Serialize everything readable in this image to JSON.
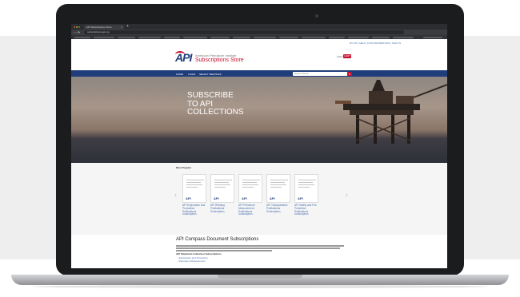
{
  "browser": {
    "tab_title": "API Subscriptions Store",
    "tab_close": "×",
    "new_tab": "+",
    "nav_buttons": "‹ › ⟳",
    "url": "subscriptions.api.org"
  },
  "site": {
    "utility_links": "MY API  |  HELP  |  FOR INFORMATION  |  SIGN IN",
    "logo": "API",
    "brand_line1": "American Petroleum Institute",
    "brand_line2": "Subscriptions Store",
    "login_label": "LOG IN",
    "cart_label": "CART",
    "nav": [
      "HOME",
      "LOGIN",
      "SELECT SERVICES"
    ],
    "search_placeholder": "Search Store",
    "search_icon": "search-icon"
  },
  "hero": {
    "line1": "SUBSCRIBE",
    "line2": "TO API",
    "line3": "COLLECTIONS"
  },
  "popular": {
    "heading": "Most Popular",
    "cards": [
      {
        "mini": "API",
        "label_lines": [
          "API Exploration and",
          "Production",
          "Publications",
          "Subscription"
        ]
      },
      {
        "mini": "API",
        "label_lines": [
          "API Refining",
          "Publications",
          "Subscription"
        ]
      },
      {
        "mini": "API",
        "label_lines": [
          "API Petroleum",
          "Measurement",
          "Publications",
          "Subscription"
        ]
      },
      {
        "mini": "API",
        "label_lines": [
          "API Transportation",
          "Publications",
          "Subscription"
        ]
      },
      {
        "mini": "API",
        "label_lines": [
          "API Safety and Fire",
          "Protection",
          "Publications",
          "Subscription"
        ]
      }
    ],
    "arrow_left": "‹",
    "arrow_right": "›"
  },
  "compass": {
    "title": "API Compass Document Subscriptions",
    "subheading": "API Standards Collection Subscriptions",
    "bullets": [
      "Exploration and Production",
      "Petroleum Measurement"
    ]
  },
  "colors": {
    "api_red": "#c8102e",
    "api_navy": "#1f3d7a",
    "link_blue": "#4b6fae"
  }
}
